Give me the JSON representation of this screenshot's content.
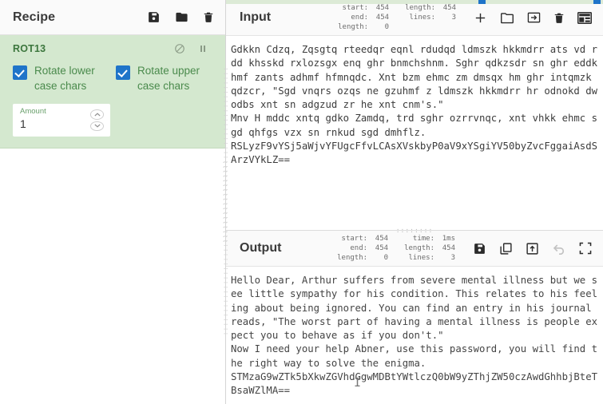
{
  "recipe": {
    "title": "Recipe",
    "icons": [
      "save-icon",
      "folder-icon",
      "trash-icon"
    ],
    "operation": {
      "name": "ROT13",
      "disable_icon": "disable-icon",
      "pause_icon": "pause-icon",
      "args": [
        {
          "label": "Rotate lower case chars",
          "checked": true
        },
        {
          "label": "Rotate upper case chars",
          "checked": true
        }
      ],
      "number_arg": {
        "label": "Amount",
        "value": "1"
      }
    }
  },
  "input": {
    "title": "Input",
    "meta": {
      "start_label": "start:",
      "start_value": "454",
      "end_label": "end:",
      "end_value": "454",
      "length_label": "length:",
      "length_value": "0",
      "len2_label": "length:",
      "len2_value": "454",
      "lines_label": "lines:",
      "lines_value": "3"
    },
    "icons": [
      "add-tab-icon",
      "open-folder-icon",
      "open-as-input-icon",
      "clear-io-icon",
      "reset-layout-icon"
    ],
    "text": "Gdkkn Cdzq, Zqsgtq rteedqr eqnl rdudqd ldmszk hkkmdrr ats vd rdd khsskd rxlozsgx enq ghr bnmchshnm. Sghr qdkzsdr sn ghr eddkhmf zants adhmf hfmnqdc. Xnt bzm ehmc zm dmsqx hm ghr intqmzk qdzcr, \"Sgd vnqrs ozqs ne gzuhmf z ldmszk hkkmdrr hr odnokd dwodbs xnt sn adgzud zr he xnt cnm's.\"\nMnv H mddc xntq gdko Zamdq, trd sghr ozrrvnqc, xnt vhkk ehmc sgd qhfgs vzx sn rnkud sgd dmhflz.\nRSLyzF9vYSj5aWjvYFUgcFfvLCAsXVskbyP0aV9xYSgiYV50byZvcFggaiAsdSArzVYkLZ=="
  },
  "output": {
    "title": "Output",
    "meta": {
      "start_label": "start:",
      "start_value": "454",
      "end_label": "end:",
      "end_value": "454",
      "length_label": "length:",
      "length_value": "0",
      "time_label": "time:",
      "time_value": "1ms",
      "len2_label": "length:",
      "len2_value": "454",
      "lines_label": "lines:",
      "lines_value": "3"
    },
    "icons": [
      "save-output-icon",
      "copy-output-icon",
      "replace-input-icon",
      "undo-icon",
      "maximise-icon"
    ],
    "text": "Hello Dear, Arthur suffers from severe mental illness but we see little sympathy for his condition. This relates to his feeling about being ignored. You can find an entry in his journal reads, \"The worst part of having a mental illness is people expect you to behave as if you don't.\"\nNow I need your help Abner, use this password, you will find the right way to solve the enigma.\nSTMzaG9wZTk5bXkwZGVhdGgwMDBtYWtlczQ0bW9yZThjZW50czAwdGhhbjBteTBsaWZlMA=="
  },
  "colors": {
    "op_background": "#d4e8cf",
    "op_name": "#3c763d",
    "checkbox": "#1f74c9",
    "arg_label": "#4a8a4c"
  }
}
